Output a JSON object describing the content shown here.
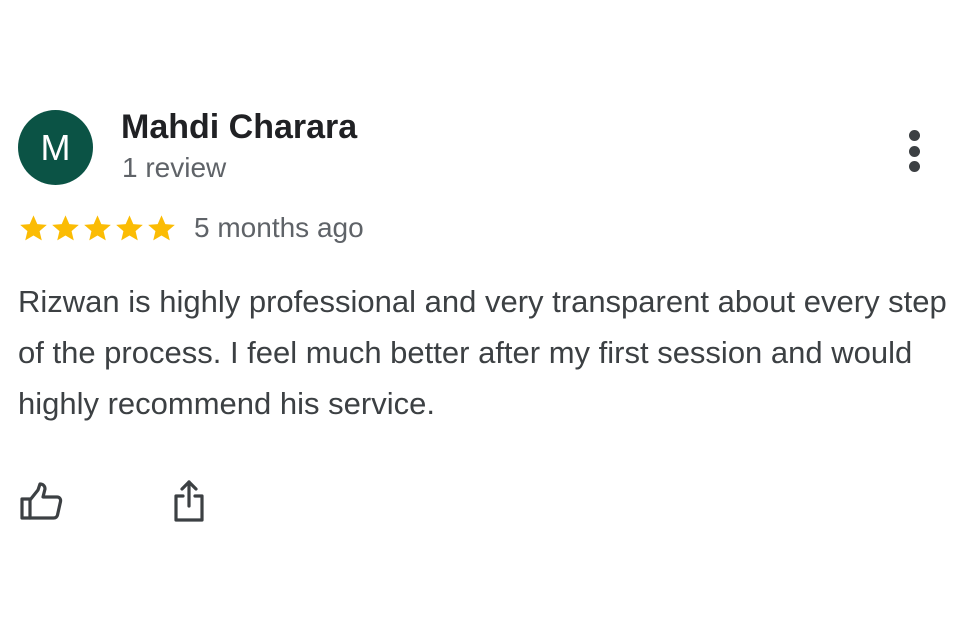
{
  "review": {
    "author": {
      "initial": "M",
      "name": "Mahdi Charara",
      "review_count": "1 review",
      "avatar_color": "#0b5345"
    },
    "rating": {
      "stars": 5,
      "max_stars": 5,
      "star_color": "#fbbc04"
    },
    "date": "5 months ago",
    "text": "Rizwan is highly professional and very transparent about every step of the process. I feel much better after my first session and would highly recommend his service.",
    "actions": {
      "like_icon": "thumb-up-icon",
      "share_icon": "share-icon",
      "more_icon": "more-vert-icon"
    }
  }
}
